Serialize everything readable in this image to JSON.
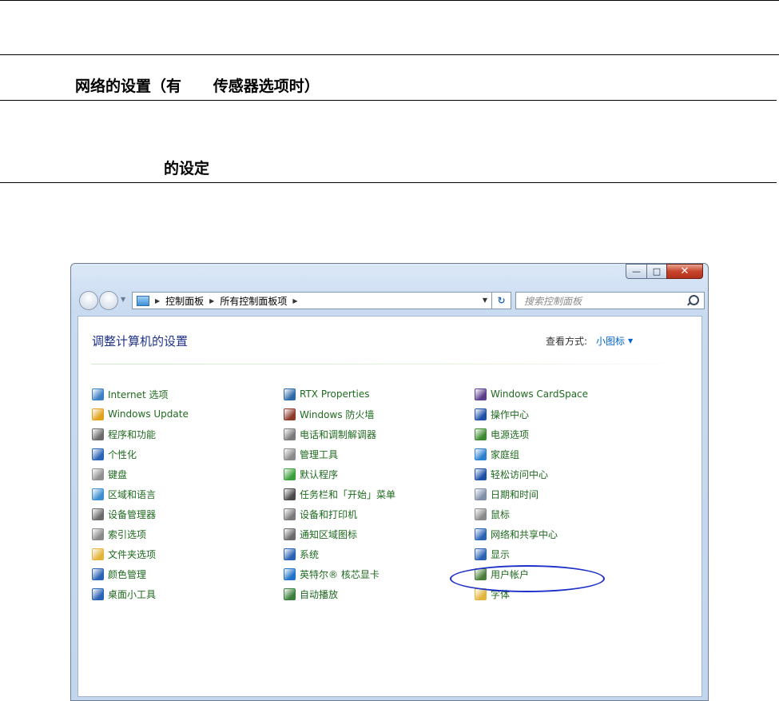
{
  "document": {
    "section_heading": "网络的设置（有      传感器选项时）",
    "subsection_heading": "的设定"
  },
  "window": {
    "caption_buttons": {
      "minimize": "—",
      "maximize": "□",
      "close": "✕"
    },
    "address_bar": {
      "crumbs": [
        "控制面板",
        "所有控制面板项"
      ]
    },
    "search": {
      "placeholder": "搜索控制面板"
    },
    "page_title": "调整计算机的设置",
    "view_by": {
      "label": "查看方式:",
      "value": "小图标"
    },
    "items": [
      {
        "label": "Internet 选项",
        "icon": "internet-options-icon",
        "color": "#3b7fc4"
      },
      {
        "label": "RTX Properties",
        "icon": "rtx-properties-icon",
        "color": "#2f6aa8"
      },
      {
        "label": "Windows CardSpace",
        "icon": "cardspace-icon",
        "color": "#5a3c8c"
      },
      {
        "label": "Windows Update",
        "icon": "windows-update-icon",
        "color": "#e0a21c"
      },
      {
        "label": "Windows 防火墙",
        "icon": "firewall-icon",
        "color": "#8c3a2a"
      },
      {
        "label": "操作中心",
        "icon": "action-center-flag-icon",
        "color": "#1d4fa8"
      },
      {
        "label": "程序和功能",
        "icon": "programs-features-icon",
        "color": "#6b6b6b"
      },
      {
        "label": "电话和调制解调器",
        "icon": "phone-modem-icon",
        "color": "#7a7a7a"
      },
      {
        "label": "电源选项",
        "icon": "power-options-icon",
        "color": "#3c8a2e"
      },
      {
        "label": "个性化",
        "icon": "personalization-icon",
        "color": "#2a62b5"
      },
      {
        "label": "管理工具",
        "icon": "admin-tools-icon",
        "color": "#8a8a8a"
      },
      {
        "label": "家庭组",
        "icon": "homegroup-icon",
        "color": "#2a7fd0"
      },
      {
        "label": "键盘",
        "icon": "keyboard-icon",
        "color": "#909090"
      },
      {
        "label": "默认程序",
        "icon": "default-programs-icon",
        "color": "#3aa03a"
      },
      {
        "label": "轻松访问中心",
        "icon": "ease-of-access-icon",
        "color": "#1d4fa8"
      },
      {
        "label": "区域和语言",
        "icon": "region-language-icon",
        "color": "#3b8fd0"
      },
      {
        "label": "任务栏和「开始」菜单",
        "icon": "taskbar-start-menu-icon",
        "color": "#4a4a4a"
      },
      {
        "label": "日期和时间",
        "icon": "date-time-icon",
        "color": "#7f8fa8"
      },
      {
        "label": "设备管理器",
        "icon": "device-manager-icon",
        "color": "#6b6b6b"
      },
      {
        "label": "设备和打印机",
        "icon": "devices-printers-icon",
        "color": "#7a7a7a"
      },
      {
        "label": "鼠标",
        "icon": "mouse-icon",
        "color": "#8a8a8a"
      },
      {
        "label": "索引选项",
        "icon": "indexing-options-icon",
        "color": "#8a8a8a"
      },
      {
        "label": "通知区域图标",
        "icon": "notification-area-icon",
        "color": "#6b6b6b"
      },
      {
        "label": "网络和共享中心",
        "icon": "network-sharing-center-icon",
        "color": "#2a62b5"
      },
      {
        "label": "文件夹选项",
        "icon": "folder-options-icon",
        "color": "#e3b33a"
      },
      {
        "label": "系统",
        "icon": "system-icon",
        "color": "#2a62b5"
      },
      {
        "label": "显示",
        "icon": "display-icon",
        "color": "#2a62b5"
      },
      {
        "label": "颜色管理",
        "icon": "color-management-icon",
        "color": "#2a62b5"
      },
      {
        "label": "英特尔® 核芯显卡",
        "icon": "intel-graphics-icon",
        "color": "#1f73c8"
      },
      {
        "label": "用户帐户",
        "icon": "user-accounts-icon",
        "color": "#4a7f3a"
      },
      {
        "label": "桌面小工具",
        "icon": "desktop-gadgets-icon",
        "color": "#2a62b5"
      },
      {
        "label": "自动播放",
        "icon": "autoplay-icon",
        "color": "#3a7f3a"
      },
      {
        "label": "字体",
        "icon": "fonts-icon",
        "color": "#e3b33a"
      }
    ]
  }
}
